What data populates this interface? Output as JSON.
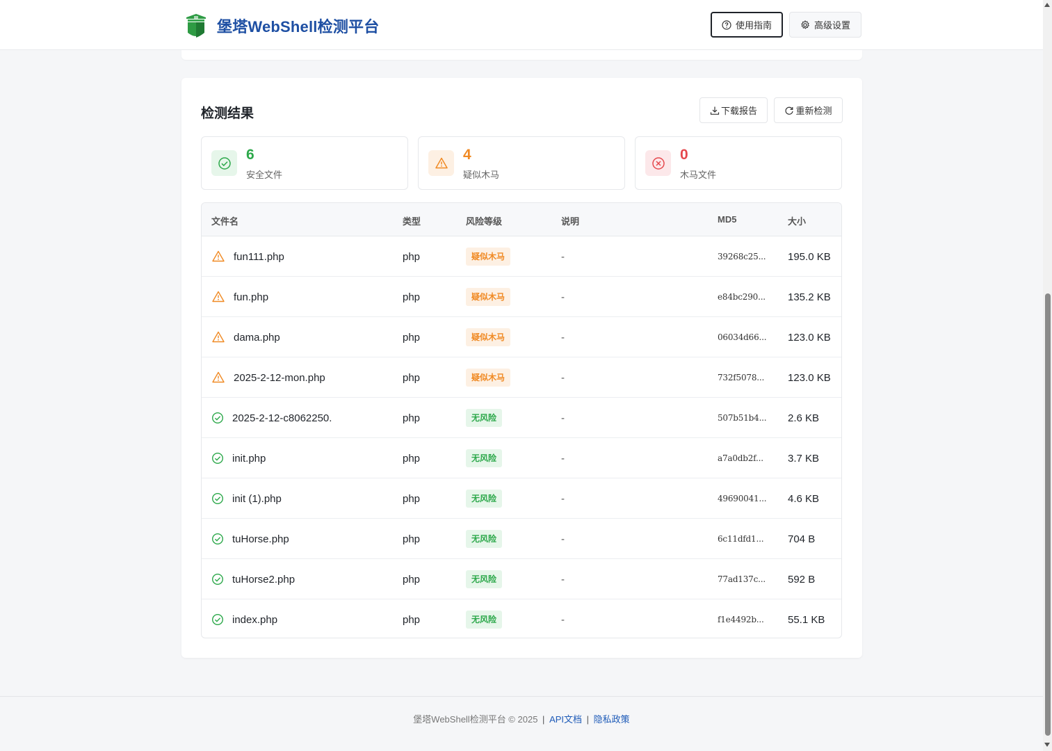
{
  "header": {
    "brand_title": "堡塔WebShell检测平台",
    "logo_icon": "shield-tower-icon",
    "guide_label": "使用指南",
    "settings_label": "高级设置"
  },
  "results": {
    "title": "检测结果",
    "download_label": "下载报告",
    "recheck_label": "重新检测"
  },
  "stats": {
    "safe": {
      "count": "6",
      "label": "安全文件",
      "color": "#2ca84a"
    },
    "suspicious": {
      "count": "4",
      "label": "疑似木马",
      "color": "#f08a24"
    },
    "trojan": {
      "count": "0",
      "label": "木马文件",
      "color": "#e5484d"
    }
  },
  "table": {
    "columns": {
      "name": "文件名",
      "type": "类型",
      "risk": "风险等级",
      "desc": "说明",
      "md5": "MD5",
      "size": "大小"
    },
    "rows": [
      {
        "status": "warning",
        "name": "fun111.php",
        "type": "php",
        "risk": "疑似木马",
        "desc": "-",
        "md5": "39268c25...",
        "size": "195.0 KB"
      },
      {
        "status": "warning",
        "name": "fun.php",
        "type": "php",
        "risk": "疑似木马",
        "desc": "-",
        "md5": "e84bc290...",
        "size": "135.2 KB"
      },
      {
        "status": "warning",
        "name": "dama.php",
        "type": "php",
        "risk": "疑似木马",
        "desc": "-",
        "md5": "06034d66...",
        "size": "123.0 KB"
      },
      {
        "status": "warning",
        "name": "2025-2-12-mon.php",
        "type": "php",
        "risk": "疑似木马",
        "desc": "-",
        "md5": "732f5078...",
        "size": "123.0 KB"
      },
      {
        "status": "safe",
        "name": "2025-2-12-c8062250.",
        "type": "php",
        "risk": "无风险",
        "desc": "-",
        "md5": "507b51b4...",
        "size": "2.6 KB"
      },
      {
        "status": "safe",
        "name": "init.php",
        "type": "php",
        "risk": "无风险",
        "desc": "-",
        "md5": "a7a0db2f...",
        "size": "3.7 KB"
      },
      {
        "status": "safe",
        "name": "init (1).php",
        "type": "php",
        "risk": "无风险",
        "desc": "-",
        "md5": "49690041...",
        "size": "4.6 KB"
      },
      {
        "status": "safe",
        "name": "tuHorse.php",
        "type": "php",
        "risk": "无风险",
        "desc": "-",
        "md5": "6c11dfd1...",
        "size": "704 B"
      },
      {
        "status": "safe",
        "name": "tuHorse2.php",
        "type": "php",
        "risk": "无风险",
        "desc": "-",
        "md5": "77ad137c...",
        "size": "592 B"
      },
      {
        "status": "safe",
        "name": "index.php",
        "type": "php",
        "risk": "无风险",
        "desc": "-",
        "md5": "f1e4492b...",
        "size": "55.1 KB"
      }
    ]
  },
  "footer": {
    "copyright": "堡塔WebShell检测平台 © 2025",
    "sep": "|",
    "api_link": "API文档",
    "privacy_link": "隐私政策"
  }
}
